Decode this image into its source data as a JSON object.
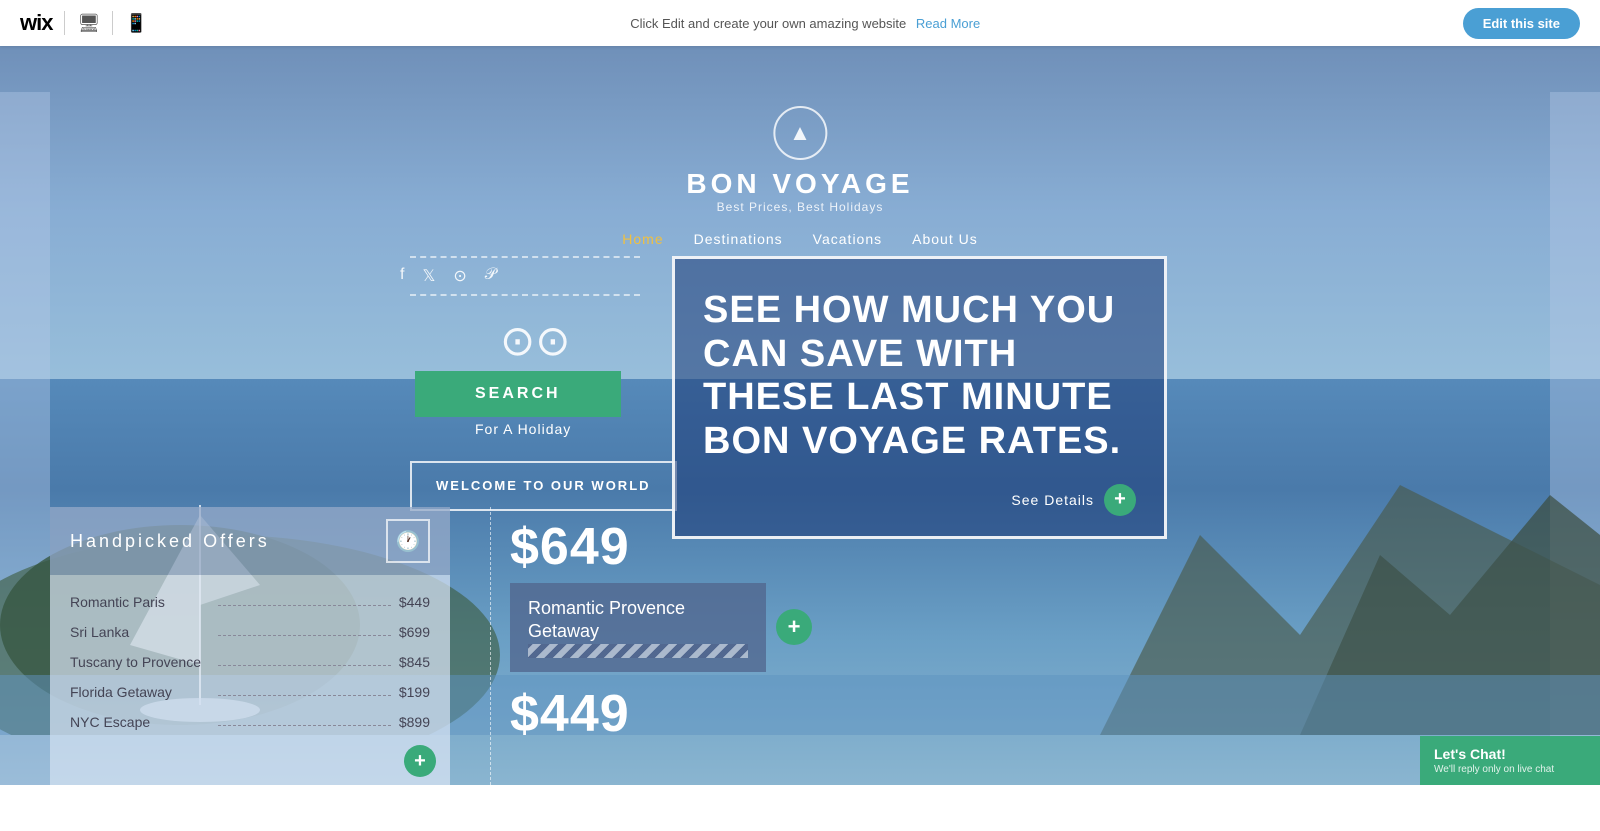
{
  "topbar": {
    "wix_label": "wix",
    "message": "Click Edit and create your own amazing website",
    "read_more": "Read More",
    "edit_btn": "Edit this site"
  },
  "logo": {
    "brand_name": "BON VOYAGE",
    "tagline": "Best Prices, Best Holidays"
  },
  "nav": {
    "items": [
      {
        "label": "Home",
        "active": true
      },
      {
        "label": "Destinations",
        "active": false
      },
      {
        "label": "Vacations",
        "active": false
      },
      {
        "label": "About Us",
        "active": false
      }
    ]
  },
  "search": {
    "button_label": "SEARCH",
    "subtitle": "For A Holiday"
  },
  "welcome": {
    "label": "WELCOME TO OUR WORLD"
  },
  "hero": {
    "headline": "SEE HOW MUCH YOU CAN SAVE WITH THESE LAST MINUTE BON VOYAGE RATES.",
    "see_details": "See Details"
  },
  "offers": {
    "title": "Handpicked Offers",
    "items": [
      {
        "name": "Romantic Paris",
        "price": "$449"
      },
      {
        "name": "Sri Lanka",
        "price": "$699"
      },
      {
        "name": "Tuscany to Provence",
        "price": "$845"
      },
      {
        "name": "Florida Getaway",
        "price": "$199"
      },
      {
        "name": "NYC Escape",
        "price": "$899"
      }
    ]
  },
  "right": {
    "price_1": "$649",
    "card_title": "Romantic Provence\nGetaway",
    "price_2": "$449"
  },
  "chat": {
    "title": "Let's Chat!",
    "subtitle": "We'll reply only on live chat"
  }
}
